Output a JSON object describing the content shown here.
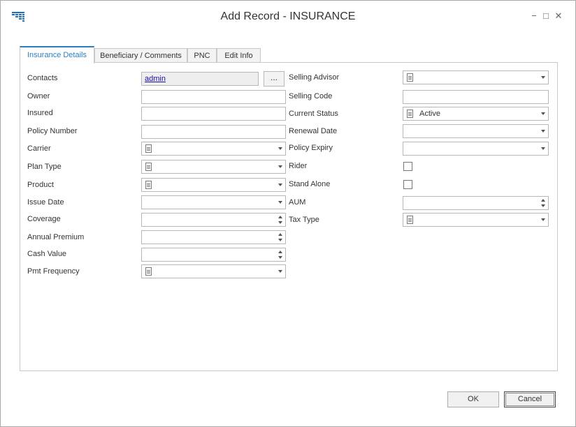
{
  "window": {
    "title": "Add Record - INSURANCE",
    "minimize_glyph": "−",
    "maximize_glyph": "□",
    "close_glyph": "✕"
  },
  "tabs": [
    {
      "label": "Insurance Details",
      "active": true
    },
    {
      "label": "Beneficiary / Comments",
      "active": false
    },
    {
      "label": "PNC",
      "active": false
    },
    {
      "label": "Edit Info",
      "active": false
    }
  ],
  "left": {
    "contacts_label": "Contacts",
    "contacts_value": "admin",
    "browse_label": "...",
    "owner_label": "Owner",
    "insured_label": "Insured",
    "policy_number_label": "Policy Number",
    "carrier_label": "Carrier",
    "plan_type_label": "Plan Type",
    "product_label": "Product",
    "issue_date_label": "Issue Date",
    "coverage_label": "Coverage",
    "annual_premium_label": "Annual Premium",
    "cash_value_label": "Cash Value",
    "pmt_frequency_label": "Pmt Frequency"
  },
  "right": {
    "selling_advisor_label": "Selling Advisor",
    "selling_code_label": "Selling Code",
    "current_status_label": "Current Status",
    "current_status_value": "Active",
    "renewal_date_label": "Renewal Date",
    "policy_expiry_label": "Policy Expiry",
    "rider_label": "Rider",
    "stand_alone_label": "Stand Alone",
    "aum_label": "AUM",
    "tax_type_label": "Tax Type"
  },
  "buttons": {
    "ok": "OK",
    "cancel": "Cancel"
  },
  "colors": {
    "accent": "#2d7ec1",
    "link": "#1a0dab",
    "app_icon": "#1f6fb8"
  },
  "icons": [
    "app-icon",
    "document-icon",
    "dropdown-arrow-icon",
    "spin-up-icon",
    "spin-down-icon"
  ]
}
